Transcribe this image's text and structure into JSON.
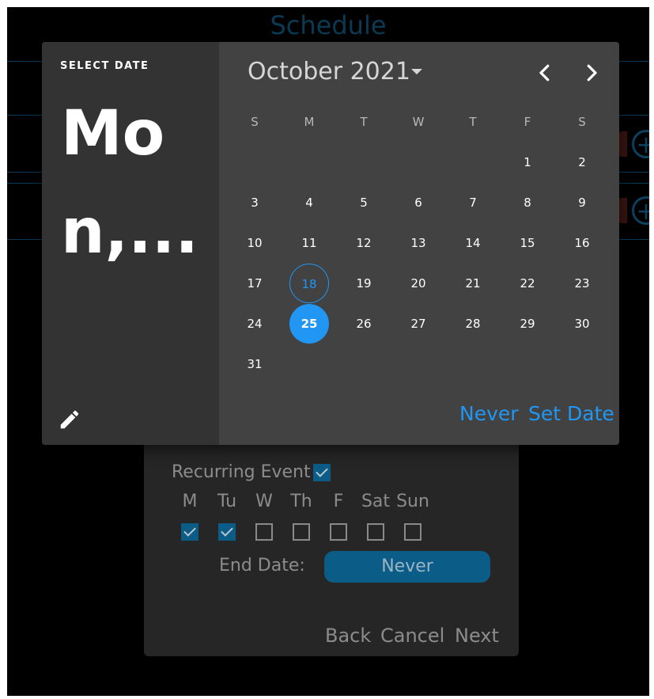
{
  "background": {
    "title": "Schedule"
  },
  "dialog": {
    "recurring_label": "Recurring Event",
    "recurring_checked": true,
    "days": [
      {
        "label": "M",
        "checked": true
      },
      {
        "label": "Tu",
        "checked": true
      },
      {
        "label": "W",
        "checked": false
      },
      {
        "label": "Th",
        "checked": false
      },
      {
        "label": "F",
        "checked": false
      },
      {
        "label": "Sat",
        "checked": false
      },
      {
        "label": "Sun",
        "checked": false
      }
    ],
    "end_date_label": "End Date:",
    "end_date_value": "Never",
    "back_label": "Back",
    "cancel_label": "Cancel",
    "next_label": "Next"
  },
  "picker": {
    "select_label": "SELECT DATE",
    "big_date": "Mon,...",
    "pencil_icon": "pencil-icon",
    "month_label": "October 2021",
    "prev_icon": "chevron-left-icon",
    "next_icon": "chevron-right-icon",
    "weekdays": [
      "S",
      "M",
      "T",
      "W",
      "T",
      "F",
      "S"
    ],
    "first_weekday_index": 5,
    "days_in_month": 31,
    "today": 18,
    "selected": 25,
    "never_label": "Never",
    "set_date_label": "Set Date",
    "accent_color": "#2196f3"
  }
}
